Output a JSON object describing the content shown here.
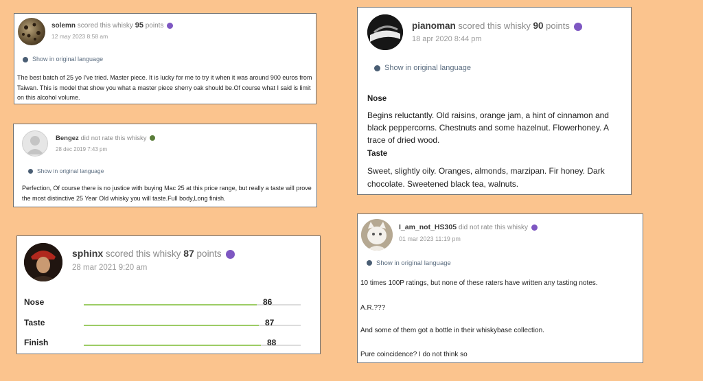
{
  "common": {
    "show_original": "Show in original language"
  },
  "review1": {
    "user": "solemn",
    "action": "scored this whisky",
    "score": "95",
    "points": "points",
    "date": "12 may 2023 8:58 am",
    "body": "The best batch of 25 yo I've tried. Master piece. It is lucky for me to try it when it was around 900 euros from Taiwan. This is model that show you what a master piece sherry oak should be.Of course what I said is limit on this alcohol volume."
  },
  "review2": {
    "user": "Bengez",
    "action": "did not rate this whisky",
    "date": "28 dec 2019 7:43 pm",
    "body": "Perfection, Of course there is no justice with buying Mac 25 at this price range, but really a taste will prove the most distinctive 25 Year Old whisky you will taste.Full body,Long finish."
  },
  "review3": {
    "user": "sphinx",
    "action": "scored this whisky",
    "score": "87",
    "points": "points",
    "date": "28 mar 2021 9:20 am",
    "bars": [
      {
        "label": "Nose",
        "value": 86
      },
      {
        "label": "Taste",
        "value": 87
      },
      {
        "label": "Finish",
        "value": 88
      }
    ]
  },
  "review4": {
    "user": "pianoman",
    "action": "scored this whisky",
    "score": "90",
    "points": "points",
    "date": "18 apr 2020 8:44 pm",
    "nose_h": "Nose",
    "nose": "Begins reluctantly. Old raisins, orange jam, a hint of cinnamon and black peppercorns. Chestnuts and some hazelnut. Flowerhoney. A trace of dried wood.",
    "taste_h": "Taste",
    "taste": "Sweet, slightly oily. Oranges, almonds, marzipan. Fir honey. Dark chocolate. Sweetened black tea, walnuts."
  },
  "review5": {
    "user": "I_am_not_HS305",
    "action": "did not rate this whisky",
    "date": "01 mar 2023 11:19 pm",
    "p1": "10 times 100P ratings, but none of these raters have written any tasting notes.",
    "p2": "A.R.???",
    "p3": "And some of them got a bottle in their whiskybase collection.",
    "p4": "Pure coincidence? I do not think so"
  },
  "colors": {
    "background": "#fbc48e",
    "badge_purple": "#7e57c2",
    "badge_green": "#5a7d3a",
    "bar_fill": "#9ccc65"
  }
}
